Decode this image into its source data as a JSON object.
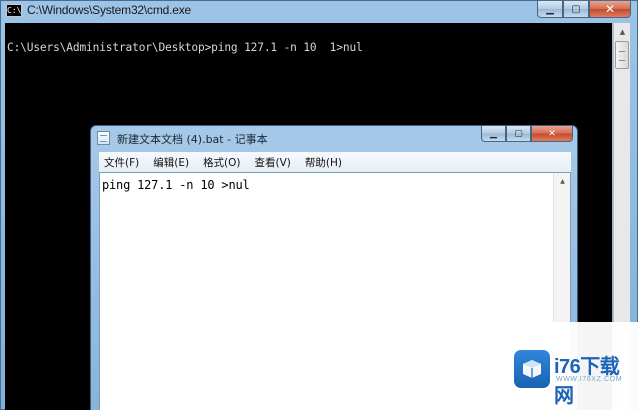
{
  "cmd": {
    "title": "C:\\Windows\\System32\\cmd.exe",
    "icon_label": "C:\\",
    "prompt_line": "C:\\Users\\Administrator\\Desktop>ping 127.1 -n 10  1>nul"
  },
  "notepad": {
    "title": "新建文本文档 (4).bat - 记事本",
    "menu": [
      "文件(F)",
      "编辑(E)",
      "格式(O)",
      "查看(V)",
      "帮助(H)"
    ],
    "content": "ping 127.1 -n 10 >nul"
  },
  "window_controls": {
    "minimize": "▁",
    "maximize": "▢",
    "close": "✕"
  },
  "watermark": {
    "brand": "i76下载网",
    "url": "WWW.I76XZ.COM"
  },
  "icons": {
    "cmd_icon": "terminal-icon",
    "notepad_icon": "notepad-icon",
    "scroll_up": "▲",
    "scroll_down": "▼"
  }
}
